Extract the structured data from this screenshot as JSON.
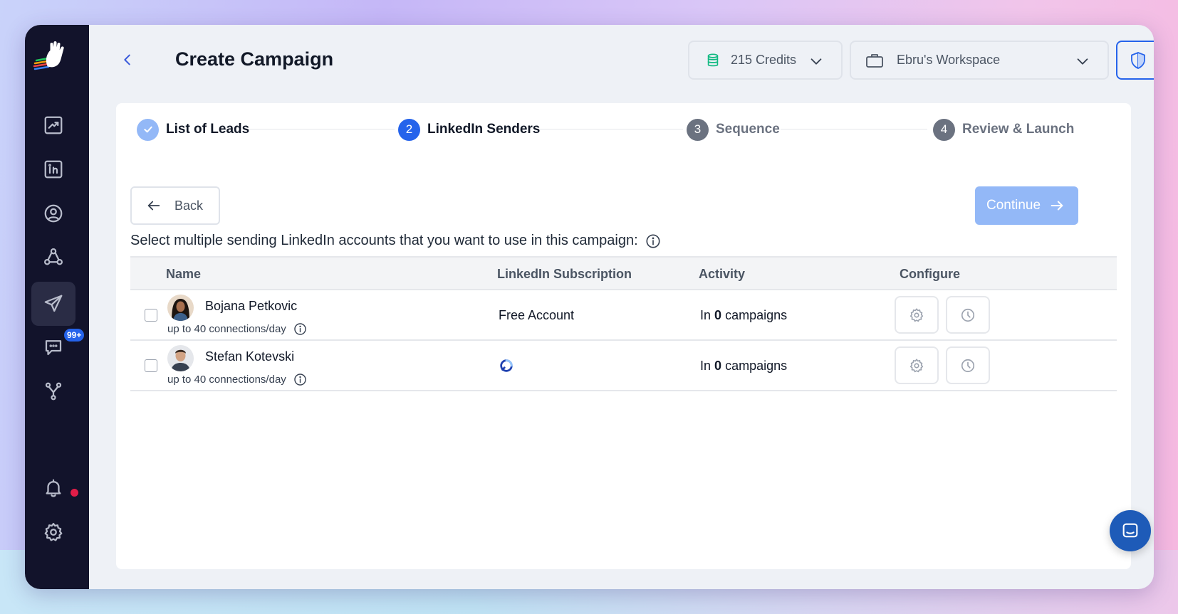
{
  "page": {
    "title": "Create Campaign"
  },
  "header": {
    "credits_label": "215 Credits",
    "workspace_label": "Ebru's Workspace"
  },
  "sidebar": {
    "items": [
      {
        "icon": "analytics-icon",
        "active": false
      },
      {
        "icon": "linkedin-icon",
        "active": false
      },
      {
        "icon": "user-circle-icon",
        "active": false
      },
      {
        "icon": "network-icon",
        "active": false
      },
      {
        "icon": "send-icon",
        "active": true
      },
      {
        "icon": "messages-icon",
        "active": false,
        "badge": "99+"
      },
      {
        "icon": "integrations-icon",
        "active": false
      }
    ],
    "bottom_items": [
      {
        "icon": "bell-icon",
        "has_dot": true
      },
      {
        "icon": "settings-icon"
      }
    ]
  },
  "stepper": {
    "steps": [
      {
        "number": "1",
        "label": "List of Leads",
        "state": "done"
      },
      {
        "number": "2",
        "label": "LinkedIn Senders",
        "state": "current"
      },
      {
        "number": "3",
        "label": "Sequence",
        "state": "upcoming"
      },
      {
        "number": "4",
        "label": "Review & Launch",
        "state": "upcoming"
      }
    ]
  },
  "actions": {
    "back_label": "Back",
    "continue_label": "Continue"
  },
  "instruction": "Select multiple sending LinkedIn accounts that you want to use in this campaign:",
  "table": {
    "headers": {
      "name": "Name",
      "subscription": "LinkedIn Subscription",
      "activity": "Activity",
      "configure": "Configure"
    },
    "rows": [
      {
        "name": "Bojana Petkovic",
        "limit": "up to 40 connections/day",
        "subscription": "Free Account",
        "activity_prefix": "In",
        "activity_count": "0",
        "activity_suffix": "campaigns"
      },
      {
        "name": "Stefan Kotevski",
        "limit": "up to 40 connections/day",
        "subscription": "",
        "activity_prefix": "In",
        "activity_count": "0",
        "activity_suffix": "campaigns"
      }
    ]
  },
  "colors": {
    "primary": "#2563eb",
    "sidebar": "#12132b",
    "continue_disabled": "#93b8f7"
  }
}
